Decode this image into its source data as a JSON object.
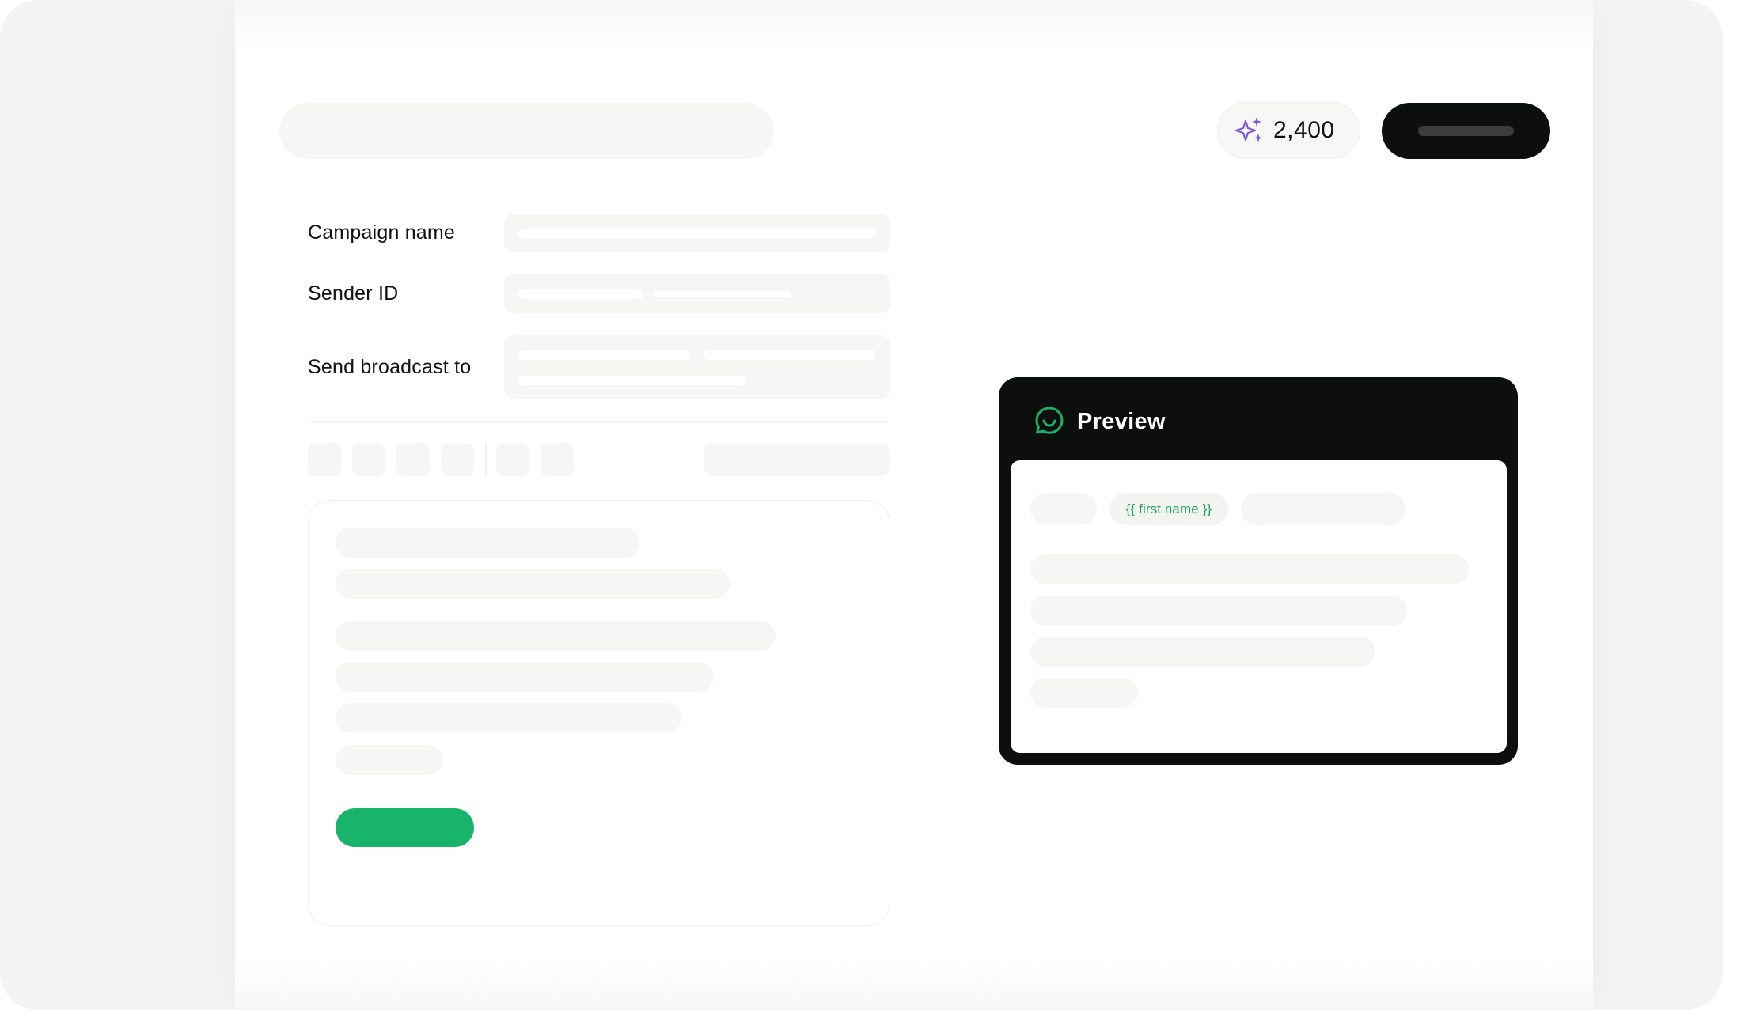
{
  "header": {
    "credits_value": "2,400",
    "credits_icon": "sparkle-icon",
    "cta_label": ""
  },
  "form": {
    "fields": [
      {
        "label": "Campaign name"
      },
      {
        "label": "Sender ID"
      },
      {
        "label": "Send broadcast to"
      }
    ]
  },
  "preview": {
    "title": "Preview",
    "icon": "whatsapp-icon",
    "variable_chip": "{{ first name }}"
  },
  "colors": {
    "accent_green": "#18b46a",
    "dark": "#0c0f0e",
    "sparkle_purple": "#7b5bd6"
  }
}
